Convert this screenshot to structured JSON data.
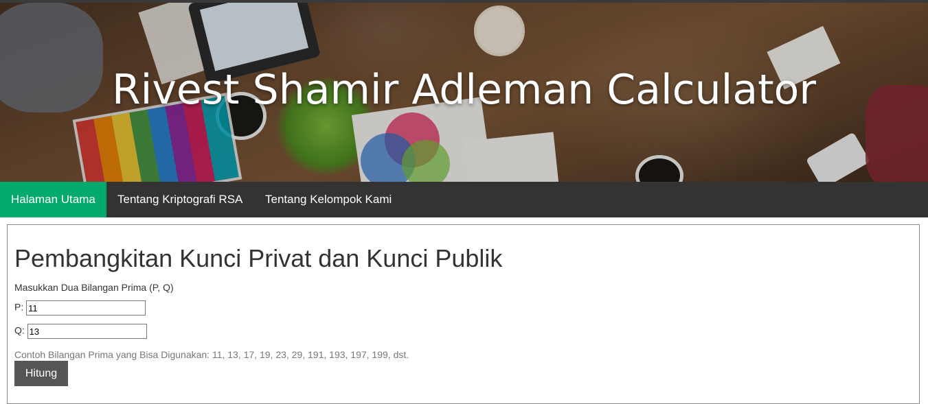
{
  "hero": {
    "title": "Rivest Shamir Adleman Calculator"
  },
  "nav": {
    "items": [
      {
        "label": "Halaman Utama",
        "active": true
      },
      {
        "label": "Tentang Kriptografi RSA",
        "active": false
      },
      {
        "label": "Tentang Kelompok Kami",
        "active": false
      }
    ]
  },
  "main": {
    "title": "Pembangkitan Kunci Privat dan Kunci Publik",
    "instruction": "Masukkan Dua Bilangan Prima (P, Q)",
    "p_label": "P:",
    "p_value": "11",
    "q_label": "Q:",
    "q_value": "13",
    "hint": "Contoh Bilangan Prima yang Bisa Digunakan: 11, 13, 17, 19, 23, 29, 191, 193, 197, 199, dst.",
    "button_label": "Hitung"
  },
  "colors": {
    "nav_bg": "#333333",
    "nav_active": "#04aa6d",
    "button_bg": "#555555"
  }
}
